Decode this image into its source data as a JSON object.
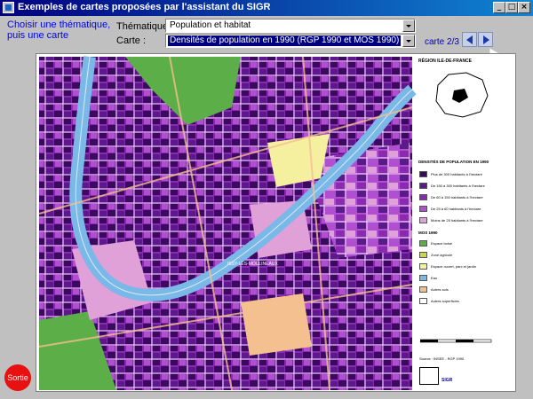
{
  "window": {
    "title": "Exemples de cartes proposées par l'assistant du SIGR"
  },
  "intro_text": "Choisir une thématique, puis une carte",
  "form": {
    "thematique_label": "Thématique :",
    "thematique_value": "Population et habitat",
    "carte_label": "Carte :",
    "carte_value": "Densités de population en 1990 (RGP 1990 et MOS 1990)"
  },
  "navigation": {
    "counter": "carte 2/3"
  },
  "legend": {
    "title": "RÉGION ILE-DE-FRANCE",
    "section1_title": "DENSITÉS DE POPULATION EN 1990",
    "section1_items": [
      {
        "label": "Plus de 300 habitants à l'hectare",
        "color": "#3a0a5e"
      },
      {
        "label": "De 150 à 300 habitants à l'hectare",
        "color": "#5a1a8a"
      },
      {
        "label": "De 60 à 150 habitants à l'hectare",
        "color": "#8a2ab0"
      },
      {
        "label": "De 25 à 60 habitants à l'hectare",
        "color": "#b050d0"
      },
      {
        "label": "Moins de 25 habitants à l'hectare",
        "color": "#e0a0d8"
      }
    ],
    "section2_title": "MOS 1990",
    "section2_items": [
      {
        "label": "Espace boisé",
        "color": "#5cae48"
      },
      {
        "label": "Zone agricole",
        "color": "#c8d648"
      },
      {
        "label": "Espace ouvert, parc et jardin",
        "color": "#f4f0a0"
      },
      {
        "label": "Eau",
        "color": "#7ab8e8"
      },
      {
        "label": "Autres sols",
        "color": "#f4c090"
      },
      {
        "label": "Autres superficies",
        "color": "#ffffff"
      }
    ],
    "source": "Source : INSEE - RGP 1990",
    "logo_text": "SIGR"
  },
  "map": {
    "place_label": "ISSY-LES-MOULINEAUX"
  },
  "buttons": {
    "sortie": "Sortie"
  },
  "colors": {
    "titlebar": "#000080",
    "accent_text": "#0000ff",
    "water": "#7ab8e8",
    "dense": "#3a0a5e",
    "medium": "#8a2ab0",
    "light": "#e0a0d8",
    "forest": "#5cae48",
    "sortie": "#e81010"
  },
  "icons": {
    "app": "app-icon",
    "minimize": "minimize-icon",
    "maximize": "maximize-icon",
    "close": "close-icon",
    "prev": "triangle-left-icon",
    "next": "triangle-right-icon"
  }
}
